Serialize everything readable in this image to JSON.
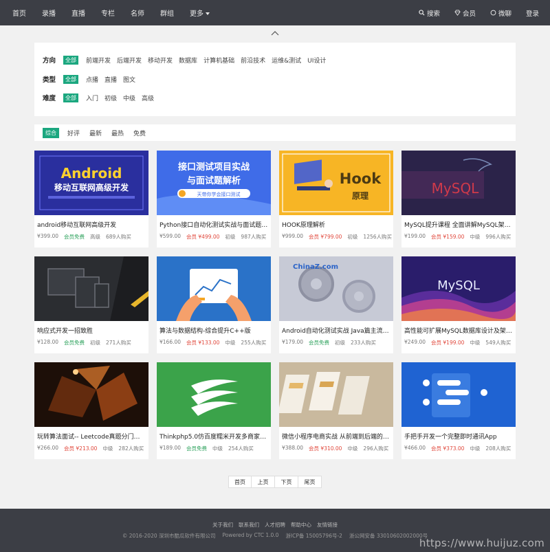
{
  "nav": {
    "items": [
      "首页",
      "录播",
      "直播",
      "专栏",
      "名师",
      "群组"
    ],
    "more": "更多"
  },
  "right_nav": {
    "search": "搜索",
    "vip": "会员",
    "weibo": "微聊",
    "login": "登录"
  },
  "filters": {
    "direction": {
      "label": "方向",
      "options": [
        "全部",
        "前端开发",
        "后端开发",
        "移动开发",
        "数据库",
        "计算机基础",
        "前沿技术",
        "运维&测试",
        "UI设计"
      ]
    },
    "type": {
      "label": "类型",
      "options": [
        "全部",
        "点播",
        "直播",
        "图文"
      ]
    },
    "difficulty": {
      "label": "难度",
      "options": [
        "全部",
        "入门",
        "初级",
        "中级",
        "高级"
      ]
    }
  },
  "sort": [
    "综合",
    "好评",
    "最新",
    "最热",
    "免费"
  ],
  "courses": [
    {
      "title": "android移动互联网高级开发",
      "price": "¥399.00",
      "vip": "会员免费",
      "vip_type": "free",
      "level": "高级",
      "buyers": "689人购买",
      "thumb_text": "Android",
      "thumb_sub": "移动互联网高级开发",
      "thumb_icon": "android-banner"
    },
    {
      "title": "Python接口自动化测试实战与面试题解析",
      "price": "¥599.00",
      "vip": "会员 ¥499.00",
      "vip_type": "price",
      "level": "初级",
      "buyers": "987人购买",
      "thumb_text": "接口测试项目实战",
      "thumb_sub": "与面试题解析",
      "thumb_badge": "天带你学会接口测试",
      "thumb_icon": "python-banner"
    },
    {
      "title": "HOOK原理解析",
      "price": "¥999.00",
      "vip": "会员 ¥799.00",
      "vip_type": "price",
      "level": "初级",
      "buyers": "1256人购买",
      "thumb_text": "Hook",
      "thumb_sub": "原理",
      "thumb_icon": "hook-banner"
    },
    {
      "title": "MySQL提升课程 全面讲解MySQL架构设计",
      "price": "¥199.00",
      "vip": "会员 ¥159.00",
      "vip_type": "price",
      "level": "中级",
      "buyers": "996人购买",
      "thumb_text": "MySQL",
      "thumb_icon": "mysql-banner"
    },
    {
      "title": "响应式开发一招致胜",
      "price": "¥128.00",
      "vip": "会员免费",
      "vip_type": "free",
      "level": "初级",
      "buyers": "271人购买",
      "thumb_icon": "devices-banner"
    },
    {
      "title": "算法与数据结构-综合提升C++版",
      "price": "¥166.00",
      "vip": "会员 ¥133.00",
      "vip_type": "price",
      "level": "中级",
      "buyers": "255人购买",
      "thumb_icon": "tablet-banner"
    },
    {
      "title": "Android自动化测试实战 Java篇主流工具",
      "price": "¥179.00",
      "vip": "会员免费",
      "vip_type": "free",
      "level": "初级",
      "buyers": "233人购买",
      "thumb_icon": "gears-banner"
    },
    {
      "title": "高性能可扩展MySQL数据库设计及架构优化",
      "price": "¥249.00",
      "vip": "会员 ¥199.00",
      "vip_type": "price",
      "level": "中级",
      "buyers": "549人购买",
      "thumb_text": "MySQL",
      "thumb_icon": "mysql-wave-banner"
    },
    {
      "title": "玩转算法面试-- Leetcode真题分门别类讲解",
      "price": "¥266.00",
      "vip": "会员 ¥213.00",
      "vip_type": "price",
      "level": "中级",
      "buyers": "282人购买",
      "thumb_icon": "polygon-banner"
    },
    {
      "title": "Thinkphp5.0仿百度糯米开发多商家电商平台",
      "price": "¥189.00",
      "vip": "会员免费",
      "vip_type": "free",
      "level": "中级",
      "buyers": "254人购买",
      "thumb_icon": "green-logo-banner"
    },
    {
      "title": "微信小程序电商实战 从前端到后端的全栈开发",
      "price": "¥388.00",
      "vip": "会员 ¥310.00",
      "vip_type": "price",
      "level": "中级",
      "buyers": "296人购买",
      "thumb_icon": "miniapp-banner"
    },
    {
      "title": "手把手开发一个完整即时通讯App",
      "price": "¥466.00",
      "vip": "会员 ¥373.00",
      "vip_type": "price",
      "level": "中级",
      "buyers": "208人购买",
      "thumb_icon": "chat-banner"
    }
  ],
  "pagination": [
    "首页",
    "上页",
    "下页",
    "尾页"
  ],
  "footer": {
    "links": [
      "关于我们",
      "联系我们",
      "人才招聘",
      "帮助中心",
      "友情链接"
    ],
    "copyright": "© 2016-2020 深圳市酷瓜软件有限公司",
    "powered": "Powered by CTC 1.0.0",
    "icp": "浙ICP备 15005796号-2",
    "police": "浙公网安备 33010602002000号"
  },
  "watermark": "https://www.huijuz.com",
  "colors": {
    "header_bg": "#3c3e45",
    "accent": "#1ba77f",
    "vip_price": "#e0463a",
    "vip_free": "#2aa05a"
  }
}
